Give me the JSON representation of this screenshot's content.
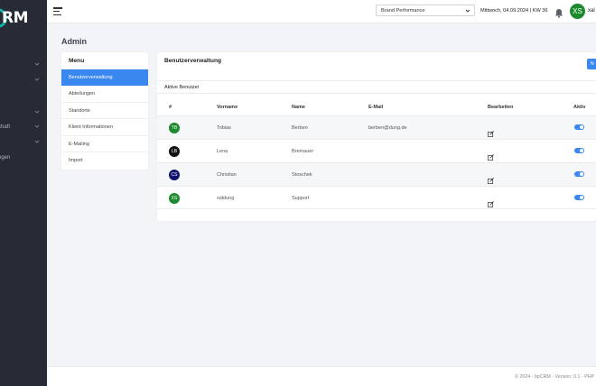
{
  "brand": {
    "logo_text": "RM"
  },
  "sidebar": {
    "items": [
      {
        "label": "",
        "chevron": true
      },
      {
        "label": "",
        "chevron": true
      },
      {
        "label": "",
        "chevron": true
      },
      {
        "label": "chaft",
        "chevron": true
      },
      {
        "label": "",
        "chevron": true
      },
      {
        "label": "ngen",
        "chevron": false
      }
    ]
  },
  "header": {
    "select_value": "Brand Performance",
    "date_text": "Mittwoch, 04.09.2024 | KW 36",
    "avatar_initials": "XS",
    "user_name": "xal"
  },
  "page": {
    "title": "Admin"
  },
  "menu": {
    "title": "Menu",
    "items": [
      {
        "label": "Benutzerverwaltung",
        "active": true
      },
      {
        "label": "Abteilungen",
        "active": false
      },
      {
        "label": "Standorte",
        "active": false
      },
      {
        "label": "Klient Informationen",
        "active": false
      },
      {
        "label": "E-Mailing",
        "active": false
      },
      {
        "label": "Import",
        "active": false
      }
    ]
  },
  "users_card": {
    "title": "Benutzerverwaltung",
    "button_label": "N",
    "subtitle": "Aktive Benutzer",
    "columns": [
      "#",
      "Vorname",
      "Name",
      "E-Mail",
      "Bearbeiten",
      "Aktiv"
    ],
    "rows": [
      {
        "initials": "TB",
        "avatar_color": "#1d8a2d",
        "first_name": "Tobias",
        "last_name": "Berben",
        "email": "berben@dung.de",
        "active": true
      },
      {
        "initials": "LB",
        "avatar_color": "#111111",
        "first_name": "Lena",
        "last_name": "Bremauer",
        "email": "",
        "active": true
      },
      {
        "initials": "CS",
        "avatar_color": "#10126e",
        "first_name": "Christian",
        "last_name": "Stoschek",
        "email": "",
        "active": true
      },
      {
        "initials": "XS",
        "avatar_color": "#1d8a2d",
        "first_name": "xaldung",
        "last_name": "Support",
        "email": "",
        "active": true
      }
    ]
  },
  "footer": {
    "text": "© 2024 - bpCRM - Version: 0.1 - PHP"
  },
  "colors": {
    "sidebar": "#262b36",
    "accent": "#3b87f0",
    "logo_ring": "#12b3a6"
  }
}
